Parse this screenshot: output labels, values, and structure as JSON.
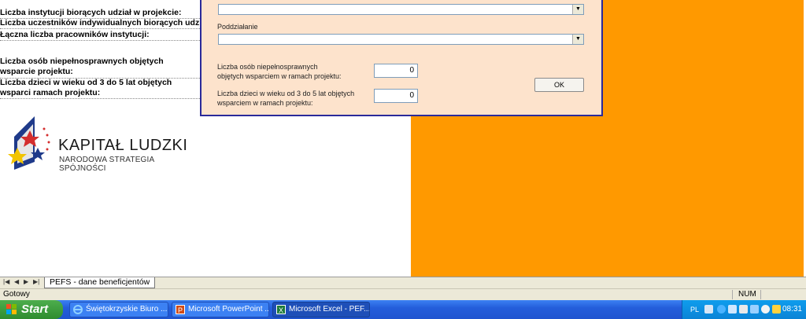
{
  "sheet": {
    "rows": [
      "Liczba instytucji biorących udział w projekcie:",
      "Liczba uczestników indywidualnych biorących udzia",
      "Łączna liczba pracowników instytucji:",
      "Liczba osób niepełnosprawnych objętych wsparcie projektu:",
      "Liczba dzieci w wieku od 3 do 5 lat objętych wsparci ramach projektu:"
    ]
  },
  "logo": {
    "title": "KAPITAŁ LUDZKI",
    "subtitle": "NARODOWA STRATEGIA SPÓJNOŚCI"
  },
  "dialog": {
    "poddzialanie_label": "Poddziałanie",
    "combo_top_value": "",
    "combo_poddzialanie_value": "",
    "niepelnosprawni_label_line1": "Liczba osób niepełnosprawnych",
    "niepelnosprawni_label_line2": "objętych wsparciem w ramach projektu:",
    "niepelnosprawni_value": "0",
    "dzieci_label_line1": "Liczba dzieci w wieku od 3 do 5 lat objętych",
    "dzieci_label_line2": "wsparciem w ramach projektu:",
    "dzieci_value": "0",
    "ok_label": "OK"
  },
  "tabs": {
    "nav": [
      "|◀",
      "◀",
      "▶",
      "▶|"
    ],
    "active_sheet": "PEFS - dane beneficjentów"
  },
  "status": {
    "text": "Gotowy",
    "num": "NUM"
  },
  "taskbar": {
    "start_label": "Start",
    "tasks": [
      {
        "label": "Świętokrzyskie Biuro ...",
        "icon": "ie-icon"
      },
      {
        "label": "Microsoft PowerPoint ...",
        "icon": "powerpoint-icon"
      },
      {
        "label": "Microsoft Excel - PEF...",
        "icon": "excel-icon"
      }
    ],
    "lang": "PL",
    "clock": "08:31"
  },
  "colors": {
    "orange": "#ff9900",
    "dialog_bg": "#fde3cc",
    "dialog_border": "#2a2a9a",
    "taskbar": "#245edb",
    "start": "#2f8c2f"
  }
}
